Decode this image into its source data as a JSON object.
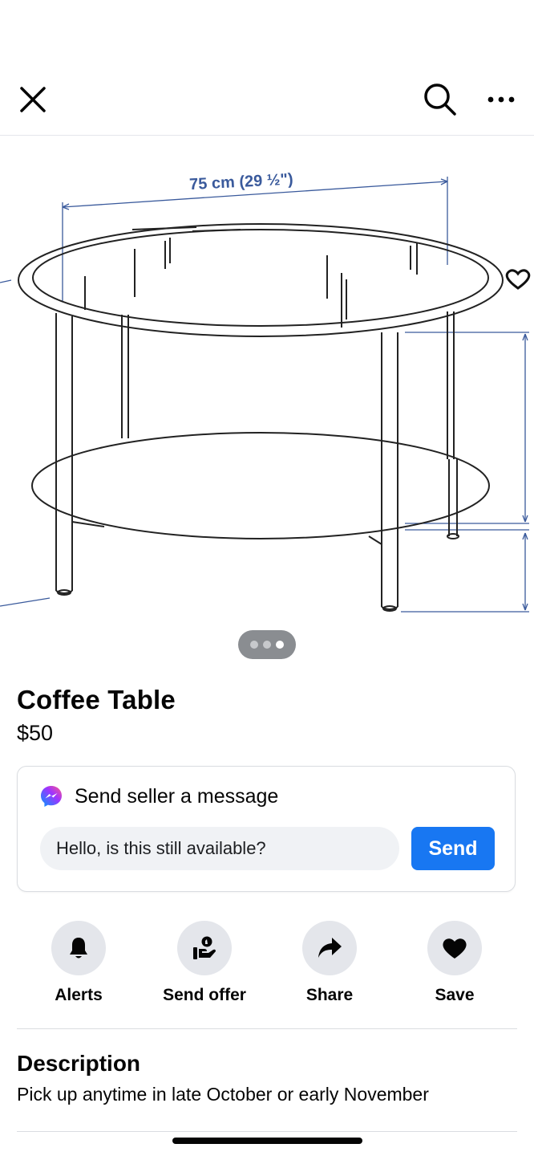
{
  "header": {
    "close_icon": "close-icon",
    "search_icon": "search-icon",
    "more_icon": "more-horizontal-icon"
  },
  "photo": {
    "dimension_label": "75 cm (29 ½\")",
    "pager": {
      "count": 3,
      "active_index": 2
    }
  },
  "listing": {
    "title": "Coffee Table",
    "price": "$50"
  },
  "message": {
    "heading": "Send seller a message",
    "icon": "messenger-icon",
    "input_value": "Hello, is this still available?",
    "send_label": "Send"
  },
  "actions": [
    {
      "label": "Alerts",
      "icon": "bell-icon"
    },
    {
      "label": "Send offer",
      "icon": "offer-hand-icon"
    },
    {
      "label": "Share",
      "icon": "share-arrow-icon"
    },
    {
      "label": "Save",
      "icon": "heart-icon"
    }
  ],
  "description": {
    "title": "Description",
    "text": "Pick up anytime in late October or early November"
  },
  "colors": {
    "accent": "#1877f2",
    "icon_circle": "#e4e6eb",
    "input_bg": "#f0f2f5",
    "dimension_line": "#3a5a9c"
  }
}
